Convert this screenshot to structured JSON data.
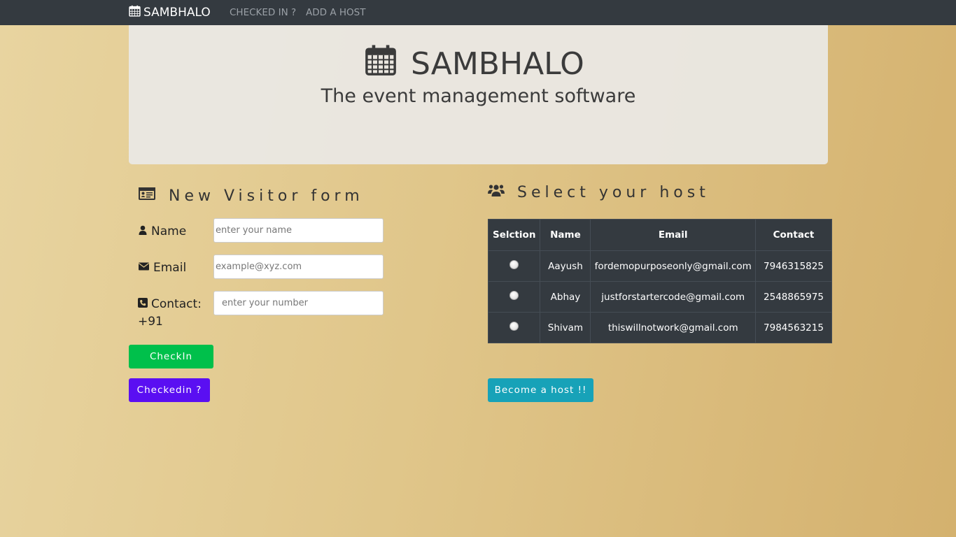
{
  "navbar": {
    "brand": "SAMBHALO",
    "links": [
      "CHECKED IN ?",
      "ADD A HOST"
    ]
  },
  "jumbotron": {
    "title": "SAMBHALO",
    "subtitle": "The event management software"
  },
  "visitor_form": {
    "title": "New Visitor form",
    "name_label": "Name",
    "name_placeholder": "enter your name",
    "email_label": "Email",
    "email_placeholder": "example@xyz.com",
    "contact_label": "Contact:",
    "contact_prefix": "+91",
    "contact_placeholder": "enter your number",
    "checkin_button": "CheckIn",
    "checkedin_button": "Checkedin ?"
  },
  "host_section": {
    "title": "Select your host",
    "columns": [
      "Selction",
      "Name",
      "Email",
      "Contact"
    ],
    "rows": [
      {
        "name": "Aayush",
        "email": "fordemopurposeonly@gmail.com",
        "contact": "7946315825"
      },
      {
        "name": "Abhay",
        "email": "justforstartercode@gmail.com",
        "contact": "2548865975"
      },
      {
        "name": "Shivam",
        "email": "thiswillnotwork@gmail.com",
        "contact": "7984563215"
      }
    ],
    "become_host_button": "Become a host !!"
  },
  "colors": {
    "navbar": "#343a40",
    "checkin": "#00c04b",
    "checkedin": "#5a0ff2",
    "become_host": "#17a2b8"
  }
}
